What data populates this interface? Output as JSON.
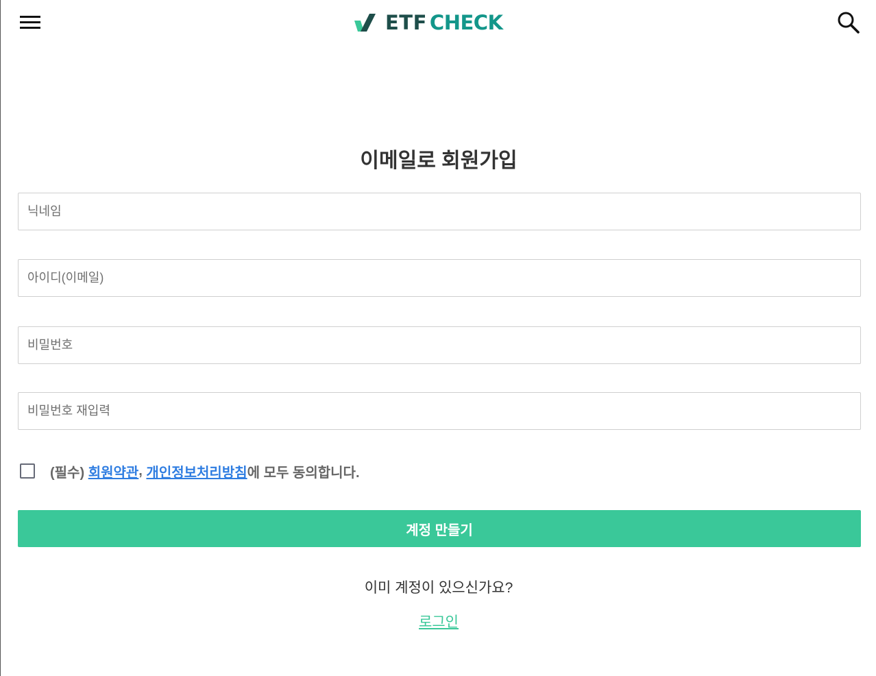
{
  "header": {
    "logo": {
      "part1": "ETF",
      "part2": "CHECK"
    }
  },
  "signup": {
    "title": "이메일로 회원가입",
    "fields": {
      "nickname_placeholder": "닉네임",
      "id_placeholder": "아이디(이메일)",
      "password_placeholder": "비밀번호",
      "password_confirm_placeholder": "비밀번호 재입력"
    },
    "agreement": {
      "required_prefix": "(필수)",
      "terms_link": "회원약관",
      "separator": ",",
      "privacy_link": "개인정보처리방침",
      "suffix": "에 모두 동의합니다."
    },
    "submit_label": "계정 만들기",
    "already_text": "이미 계정이 있으신가요?",
    "login_link": "로그인"
  },
  "colors": {
    "accent_green": "#3ac899",
    "link_blue": "#2f7de1",
    "logo_dark": "#1e4e4a",
    "logo_teal": "#13968a"
  },
  "icons": {
    "menu": "hamburger-menu-icon",
    "search": "search-icon",
    "logo_mark": "checkmark-logo-icon"
  }
}
